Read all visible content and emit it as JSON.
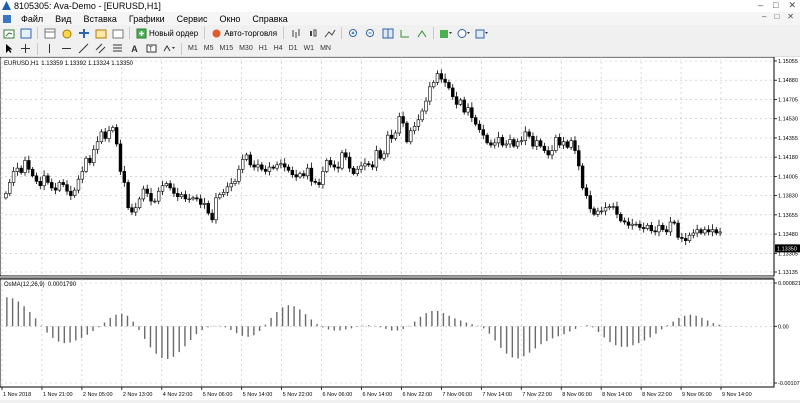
{
  "window": {
    "title": "8105305: Ava-Demo - [EURUSD,H1]",
    "controls": [
      "–",
      "□",
      "✕"
    ]
  },
  "menu": {
    "items": [
      "Файл",
      "Вид",
      "Вставка",
      "Графики",
      "Сервис",
      "Окно",
      "Справка"
    ],
    "mdi_controls": [
      "–",
      "□",
      "✕"
    ]
  },
  "toolbar": {
    "new_order": "Новый ордер",
    "autotrading": "Авто-торговля",
    "timeframes": [
      "M1",
      "M5",
      "M15",
      "M30",
      "H1",
      "H4",
      "D1",
      "W1",
      "MN"
    ]
  },
  "colors": {
    "up_candle": "#ffffff",
    "down_candle": "#000000",
    "grid": "#c0c0c0",
    "price_tag_bg": "#000000",
    "price_tag_fg": "#ffffff"
  },
  "chart_data": [
    {
      "type": "candlestick",
      "title": "EURUSD,H1  1.13359 1.13392 1.13324 1.13350",
      "symbol": "EURUSD,H1",
      "ohlc_header": "1.13359 1.13392 1.13324 1.13350",
      "current_price": "1.13350",
      "y_ticks": [
        "1.15055",
        "1.14880",
        "1.14705",
        "1.14530",
        "1.14355",
        "1.14180",
        "1.14005",
        "1.13830",
        "1.13655",
        "1.13480",
        "1.13305",
        "1.13135"
      ],
      "ylim": [
        1.13135,
        1.15055
      ],
      "x_ticks": [
        "1 Nov 2018",
        "1 Nov 21:00",
        "2 Nov 05:00",
        "2 Nov 13:00",
        "4 Nov 22:00",
        "5 Nov 06:00",
        "5 Nov 14:00",
        "5 Nov 22:00",
        "6 Nov 06:00",
        "6 Nov 14:00",
        "6 Nov 22:00",
        "7 Nov 06:00",
        "7 Nov 14:00",
        "7 Nov 22:00",
        "8 Nov 06:00",
        "8 Nov 14:00",
        "8 Nov 22:00",
        "9 Nov 06:00",
        "9 Nov 14:00"
      ],
      "close": [
        1.1385,
        1.1395,
        1.1405,
        1.1408,
        1.1404,
        1.1415,
        1.1407,
        1.1401,
        1.1396,
        1.1392,
        1.1401,
        1.1395,
        1.139,
        1.1388,
        1.1395,
        1.1393,
        1.1387,
        1.1383,
        1.1388,
        1.1398,
        1.1405,
        1.1417,
        1.1413,
        1.1425,
        1.1432,
        1.1441,
        1.1435,
        1.1442,
        1.1445,
        1.143,
        1.1405,
        1.1395,
        1.1372,
        1.1368,
        1.1372,
        1.138,
        1.1389,
        1.1385,
        1.1378,
        1.1378,
        1.1387,
        1.1392,
        1.1394,
        1.139,
        1.1385,
        1.1382,
        1.1384,
        1.138,
        1.138,
        1.1381,
        1.138,
        1.1375,
        1.1376,
        1.1367,
        1.1361,
        1.1381,
        1.1384,
        1.1386,
        1.1391,
        1.1394,
        1.1396,
        1.1407,
        1.1416,
        1.142,
        1.1411,
        1.1409,
        1.1411,
        1.1407,
        1.1405,
        1.1409,
        1.1408,
        1.1411,
        1.1412,
        1.1409,
        1.1406,
        1.1402,
        1.14,
        1.1403,
        1.1401,
        1.1408,
        1.1396,
        1.1395,
        1.1393,
        1.1405,
        1.1415,
        1.1411,
        1.1409,
        1.1408,
        1.1422,
        1.1418,
        1.1408,
        1.1403,
        1.1407,
        1.141,
        1.1412,
        1.1411,
        1.1409,
        1.1424,
        1.1417,
        1.1421,
        1.1438,
        1.1435,
        1.144,
        1.1455,
        1.1449,
        1.1432,
        1.1442,
        1.1446,
        1.1452,
        1.146,
        1.1469,
        1.1482,
        1.1486,
        1.1494,
        1.1489,
        1.1486,
        1.1481,
        1.1473,
        1.1466,
        1.147,
        1.1459,
        1.1463,
        1.1454,
        1.1448,
        1.1443,
        1.1438,
        1.1431,
        1.1429,
        1.1431,
        1.1436,
        1.1429,
        1.143,
        1.1434,
        1.1428,
        1.1432,
        1.1433,
        1.1441,
        1.1437,
        1.1428,
        1.1433,
        1.1428,
        1.1424,
        1.142,
        1.1424,
        1.1436,
        1.1429,
        1.1432,
        1.1427,
        1.1433,
        1.1424,
        1.141,
        1.139,
        1.1383,
        1.1371,
        1.1366,
        1.1369,
        1.1369,
        1.1372,
        1.1373,
        1.1373,
        1.1366,
        1.136,
        1.1359,
        1.1356,
        1.1357,
        1.1357,
        1.1354,
        1.1353,
        1.1356,
        1.1351,
        1.135,
        1.1356,
        1.1352,
        1.135,
        1.1359,
        1.1358,
        1.1345,
        1.1344,
        1.1342,
        1.1347,
        1.1349,
        1.1352,
        1.1349,
        1.1352,
        1.135,
        1.1352,
        1.1349,
        1.135
      ]
    },
    {
      "type": "bar",
      "title": "OsMA(12,26,9) 0.0001790",
      "indicator": "OsMA(12,26,9)",
      "value": "0.0001790",
      "y_ticks": [
        "0.000821",
        "0.00",
        "-0.001076"
      ],
      "ylim": [
        -0.001076,
        0.000821
      ],
      "values": [
        0.00055,
        0.00053,
        0.00047,
        0.00038,
        0.00027,
        0.00015,
        1e-05,
        -0.00012,
        -0.00022,
        -0.00029,
        -0.00032,
        -0.00031,
        -0.00027,
        -0.00022,
        -0.00016,
        -9e-05,
        -2e-05,
        7e-05,
        0.00016,
        0.00022,
        0.00024,
        0.0002,
        9e-05,
        -7e-05,
        -0.00024,
        -0.0004,
        -0.00052,
        -0.0006,
        -0.00062,
        -0.00058,
        -0.00049,
        -0.00038,
        -0.00026,
        -0.00015,
        -7e-05,
        -2e-05,
        1e-05,
        1e-05,
        -2e-05,
        -7e-05,
        -0.00013,
        -0.00018,
        -0.0002,
        -0.00017,
        -9e-05,
        3e-05,
        0.00016,
        0.00027,
        0.00036,
        0.0004,
        0.00038,
        0.00032,
        0.00023,
        0.00013,
        4e-05,
        -2e-05,
        -6e-05,
        -8e-05,
        -8e-05,
        -6e-05,
        -4e-05,
        -1e-05,
        1e-05,
        2e-05,
        1e-05,
        -2e-05,
        -5e-05,
        -8e-05,
        -8e-05,
        -5e-05,
        1e-05,
        9e-05,
        0.00018,
        0.00025,
        0.00029,
        0.00029,
        0.00025,
        0.0002,
        0.00015,
        0.00011,
        7e-05,
        4e-05,
        1e-05,
        -4e-05,
        -0.00014,
        -0.00027,
        -0.00041,
        -0.00052,
        -0.00059,
        -0.00061,
        -0.00057,
        -0.0005,
        -0.00042,
        -0.00034,
        -0.00028,
        -0.00023,
        -0.00019,
        -0.00015,
        -0.0001,
        -5e-05,
        0.0,
        2e-05,
        -2e-05,
        -0.00011,
        -0.00021,
        -0.0003,
        -0.00036,
        -0.00039,
        -0.00039,
        -0.00036,
        -0.00032,
        -0.00027,
        -0.00021,
        -0.00014,
        -6e-05,
        2e-05,
        9e-05,
        0.00016,
        0.0002,
        0.00022,
        0.0002,
        0.00016,
        0.00011,
        6e-05,
        3e-05
      ]
    }
  ]
}
